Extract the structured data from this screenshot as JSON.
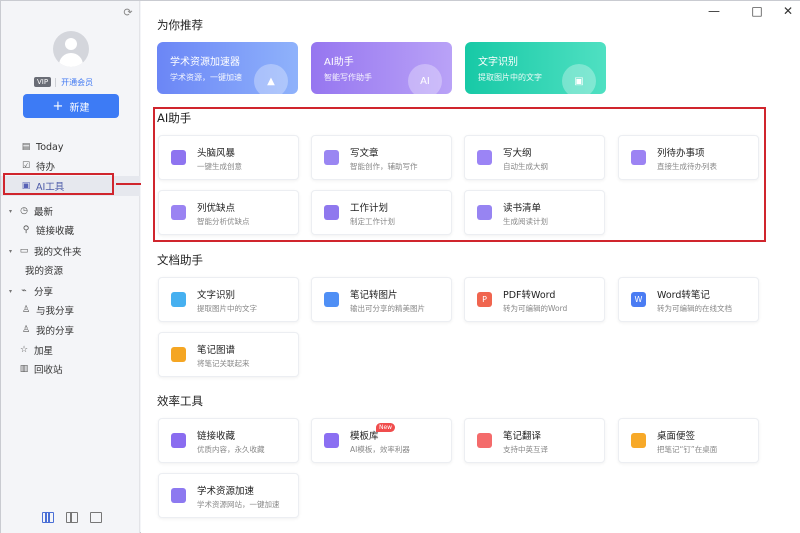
{
  "sidebar": {
    "vip_badge": "VIP",
    "vip_link": "开通会员",
    "new_button": "新建",
    "items": [
      {
        "label": "Today",
        "icon": "document-icon"
      },
      {
        "label": "待办",
        "icon": "checkbox-icon"
      },
      {
        "label": "AI工具",
        "icon": "ai-icon",
        "active": true
      },
      {
        "label": "最新",
        "icon": "clock-icon",
        "caret": true
      },
      {
        "label": "链接收藏",
        "icon": "link-icon"
      },
      {
        "label": "我的文件夹",
        "icon": "folder-icon",
        "caret": true
      },
      {
        "label": "我的资源"
      },
      {
        "label": "分享",
        "icon": "share-icon",
        "caret": true
      },
      {
        "label": "与我分享",
        "icon": "user-icon"
      },
      {
        "label": "我的分享",
        "icon": "user-icon"
      },
      {
        "label": "加星",
        "icon": "star-icon"
      },
      {
        "label": "回收站",
        "icon": "trash-icon"
      }
    ]
  },
  "window": {
    "minimize": "—",
    "maximize": "□",
    "close": "✕"
  },
  "recommend": {
    "title": "为你推荐",
    "items": [
      {
        "title": "学术资源加速器",
        "subtitle": "学术资源，一键加速",
        "color": "#6d8ef8",
        "icon": "rocket-icon"
      },
      {
        "title": "AI助手",
        "subtitle": "智能写作助手",
        "color": "#9a7cf2",
        "icon": "ai-badge-icon",
        "badge": "AI"
      },
      {
        "title": "文字识别",
        "subtitle": "提取图片中的文字",
        "color": "#1ccfae",
        "icon": "image-text-icon"
      }
    ]
  },
  "ai_section": {
    "title": "AI助手",
    "items": [
      {
        "title": "头脑风暴",
        "subtitle": "一键生成创意",
        "color": "#8e74f0",
        "icon": "brain-icon"
      },
      {
        "title": "写文章",
        "subtitle": "智能创作，辅助写作",
        "color": "#9a86f2",
        "icon": "pen-icon"
      },
      {
        "title": "写大纲",
        "subtitle": "自动生成大纲",
        "color": "#9b84f5",
        "icon": "outline-icon"
      },
      {
        "title": "列待办事项",
        "subtitle": "直接生成待办列表",
        "color": "#9c83f3",
        "icon": "calendar-icon"
      },
      {
        "title": "列优缺点",
        "subtitle": "智能分析优缺点",
        "color": "#9a83f2",
        "icon": "list-icon"
      },
      {
        "title": "工作计划",
        "subtitle": "制定工作计划",
        "color": "#8f78ee",
        "icon": "briefcase-icon"
      },
      {
        "title": "读书清单",
        "subtitle": "生成阅读计划",
        "color": "#9784f2",
        "icon": "book-icon"
      }
    ]
  },
  "doc_section": {
    "title": "文档助手",
    "items": [
      {
        "title": "文字识别",
        "subtitle": "提取图片中的文字",
        "color": "#46b0f0",
        "icon": "ocr-icon"
      },
      {
        "title": "笔记转图片",
        "subtitle": "输出可分享的精美图片",
        "color": "#4f8ff5",
        "icon": "note-image-icon"
      },
      {
        "title": "PDF转Word",
        "subtitle": "转为可编辑的Word",
        "color": "#f0654f",
        "icon": "pdf-icon",
        "glyph": "P"
      },
      {
        "title": "Word转笔记",
        "subtitle": "转为可编辑的在线文档",
        "color": "#4a7cf3",
        "icon": "word-icon",
        "glyph": "W"
      },
      {
        "title": "笔记图谱",
        "subtitle": "将笔记关联起来",
        "color": "#f5a623",
        "icon": "graph-icon"
      }
    ]
  },
  "efficiency_section": {
    "title": "效率工具",
    "items": [
      {
        "title": "链接收藏",
        "subtitle": "优质内容，永久收藏",
        "color": "#8a6cf0",
        "icon": "star-badge-icon"
      },
      {
        "title": "模板库",
        "subtitle": "AI模板，效率利器",
        "color": "#8b6ff2",
        "icon": "template-icon",
        "tag": "New"
      },
      {
        "title": "笔记翻译",
        "subtitle": "支持中英互译",
        "color": "#f46b6b",
        "icon": "translate-icon"
      },
      {
        "title": "桌面便签",
        "subtitle": "把笔记“钉”在桌面",
        "color": "#f7a928",
        "icon": "sticky-note-icon"
      },
      {
        "title": "学术资源加速",
        "subtitle": "学术资源网站，一键加速",
        "color": "#8d79f0",
        "icon": "rocket-icon"
      }
    ]
  }
}
